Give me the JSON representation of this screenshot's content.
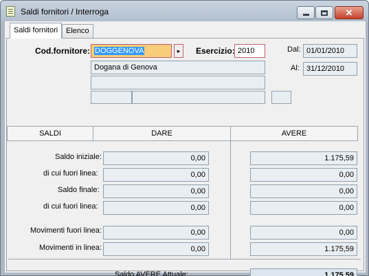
{
  "window": {
    "title": "Saldi fornitori / Interroga"
  },
  "tabs": [
    {
      "label": "Saldi fornitori",
      "active": true
    },
    {
      "label": "Elenco",
      "active": false
    }
  ],
  "header": {
    "cod_fornitore_label": "Cod.fornitore:",
    "cod_fornitore_value": "DOGGENOVA",
    "descrizione": "Dogana di Genova",
    "esercizio_label": "Esercizio:",
    "esercizio_value": "2010",
    "dal_label": "Dal:",
    "dal_value": "01/01/2010",
    "al_label": "Al:",
    "al_value": "31/12/2010"
  },
  "table": {
    "col_saldi": "SALDI",
    "col_dare": "DARE",
    "col_avere": "AVERE",
    "rows": [
      {
        "label": "Saldo iniziale:",
        "dare": "0,00",
        "avere": "1.175,59"
      },
      {
        "label": "di cui fuori linea:",
        "dare": "0,00",
        "avere": "0,00"
      },
      {
        "label": "Saldo finale:",
        "dare": "0,00",
        "avere": "0,00"
      },
      {
        "label": "di cui fuori linea:",
        "dare": "0,00",
        "avere": "0,00"
      },
      {
        "label": "Movimenti fuori linea:",
        "dare": "0,00",
        "avere": "0,00"
      },
      {
        "label": "Movimenti in linea:",
        "dare": "0,00",
        "avere": "1.175,59"
      }
    ]
  },
  "footer": {
    "label": "Saldo AVERE Attuale:",
    "value": "1.175,59"
  }
}
